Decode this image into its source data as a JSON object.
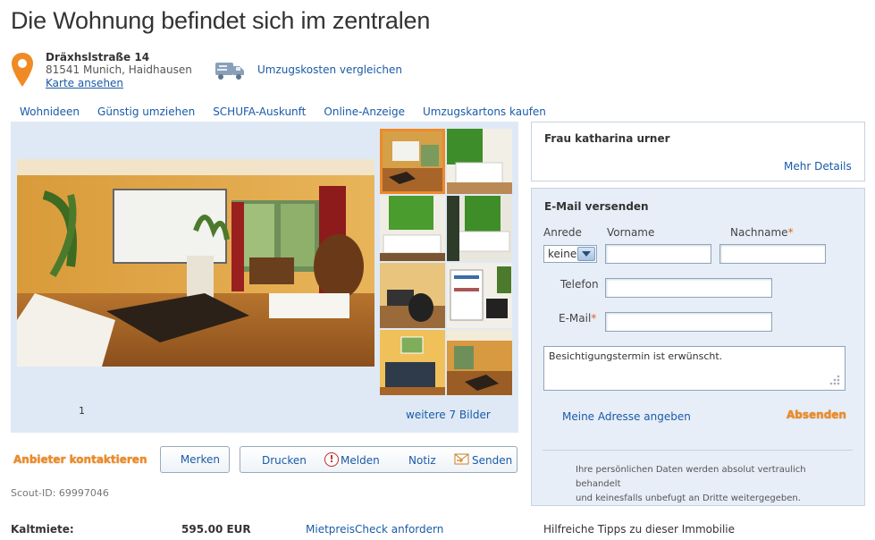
{
  "page": {
    "title": "Die Wohnung befindet sich im zentralen"
  },
  "address": {
    "street": "Dräxhslstraße 14",
    "city": "81541 Munich, Haidhausen",
    "map_link": "Karte ansehen",
    "moving_costs_link": "Umzugskosten vergleichen"
  },
  "topnav": [
    "Wohnideen",
    "Günstig umziehen",
    "SCHUFA-Auskunft",
    "Online-Anzeige",
    "Umzugskartons kaufen"
  ],
  "gallery": {
    "counter": "1",
    "more_images": "weitere 7 Bilder"
  },
  "actions": {
    "contact": "Anbieter kontaktieren",
    "merken": "Merken",
    "drucken": "Drucken",
    "melden": "Melden",
    "notiz": "Notiz",
    "senden": "Senden"
  },
  "scout_id": "Scout-ID: 69997046",
  "price": {
    "label": "Kaltmiete:",
    "value": "595.00 EUR",
    "check_link": "MietpreisCheck anfordern"
  },
  "agent": {
    "name": "Frau katharina urner",
    "details_link": "Mehr Details"
  },
  "mail_form": {
    "title": "E-Mail versenden",
    "anrede_label": "Anrede",
    "anrede_value": "keine",
    "vorname_label": "Vorname",
    "nachname_label": "Nachname",
    "telefon_label": "Telefon",
    "email_label": "E-Mail",
    "required_mark": "*",
    "message": "Besichtigungstermin ist erwünscht.",
    "address_link": "Meine Adresse angeben",
    "submit": "Absenden",
    "privacy_line1": "Ihre persönlichen Daten werden absolut vertraulich behandelt",
    "privacy_line2": "und keinesfalls unbefugt an Dritte weitergegeben."
  },
  "tips": "Hilfreiche Tipps zu dieser Immobilie",
  "colors": {
    "link": "#1a5aa8",
    "accent_orange": "#f08a24",
    "gallery_bg": "#dfe9f5",
    "form_bg": "#e7eef7"
  }
}
